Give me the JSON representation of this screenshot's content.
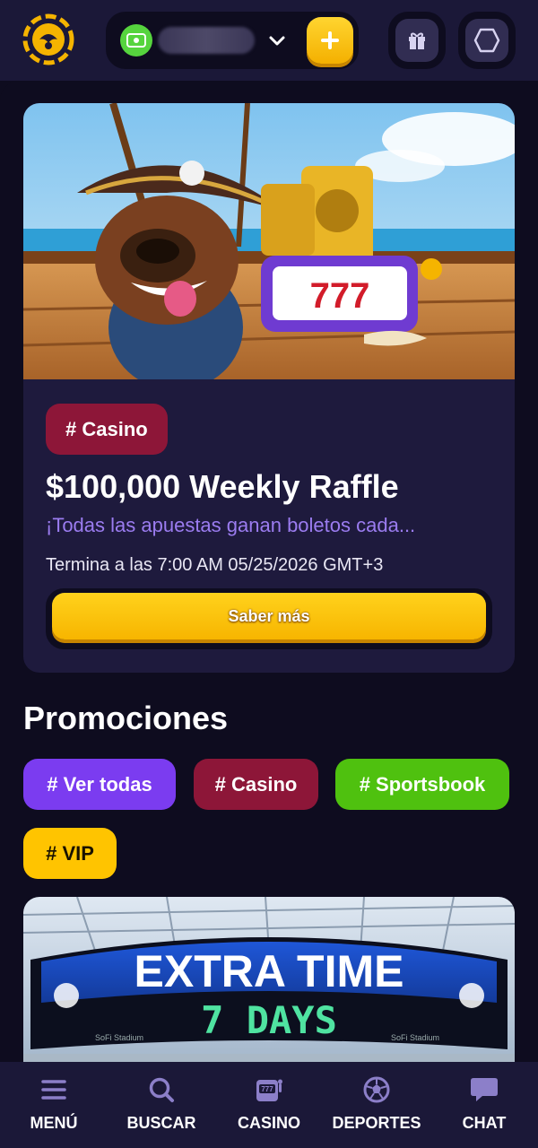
{
  "header": {
    "logo": "logo-icon",
    "wallet_icon": "cash-icon",
    "wallet_balance": "",
    "dropdown_icon": "chevron-down-icon",
    "deposit_icon": "plus-icon",
    "gift_icon": "gift-icon",
    "rank_icon": "hexagon-icon"
  },
  "featured": {
    "tag": "# Casino",
    "title": "$100,000 Weekly Raffle",
    "subtitle": "¡Todas las apuestas ganan boletos cada...",
    "ends": "Termina a las 7:00 AM 05/25/2026 GMT+3",
    "cta": "Saber más",
    "banner_reels": "777"
  },
  "promotions": {
    "title": "Promociones",
    "filters": [
      "# Ver todas",
      "# Casino",
      "# Sportsbook",
      "# VIP"
    ],
    "card": {
      "headline": "EXTRA TIME",
      "scoreboard": "7 DAYS",
      "venue": "SoFi Stadium"
    }
  },
  "bottom_nav": [
    {
      "label": "MENÚ",
      "icon": "menu-icon"
    },
    {
      "label": "BUSCAR",
      "icon": "search-icon"
    },
    {
      "label": "CASINO",
      "icon": "slot-machine-icon"
    },
    {
      "label": "DEPORTES",
      "icon": "soccer-ball-icon"
    },
    {
      "label": "CHAT",
      "icon": "chat-bubble-icon"
    }
  ],
  "colors": {
    "background": "#0e0c1f",
    "surface": "#1b1838",
    "card": "#1e1a3d",
    "accent_yellow": "#ffc400",
    "casino_tag": "#8d1638",
    "all_tag": "#7b3cf0",
    "sports_tag": "#4fc10f",
    "subtitle": "#9b7cf0"
  }
}
